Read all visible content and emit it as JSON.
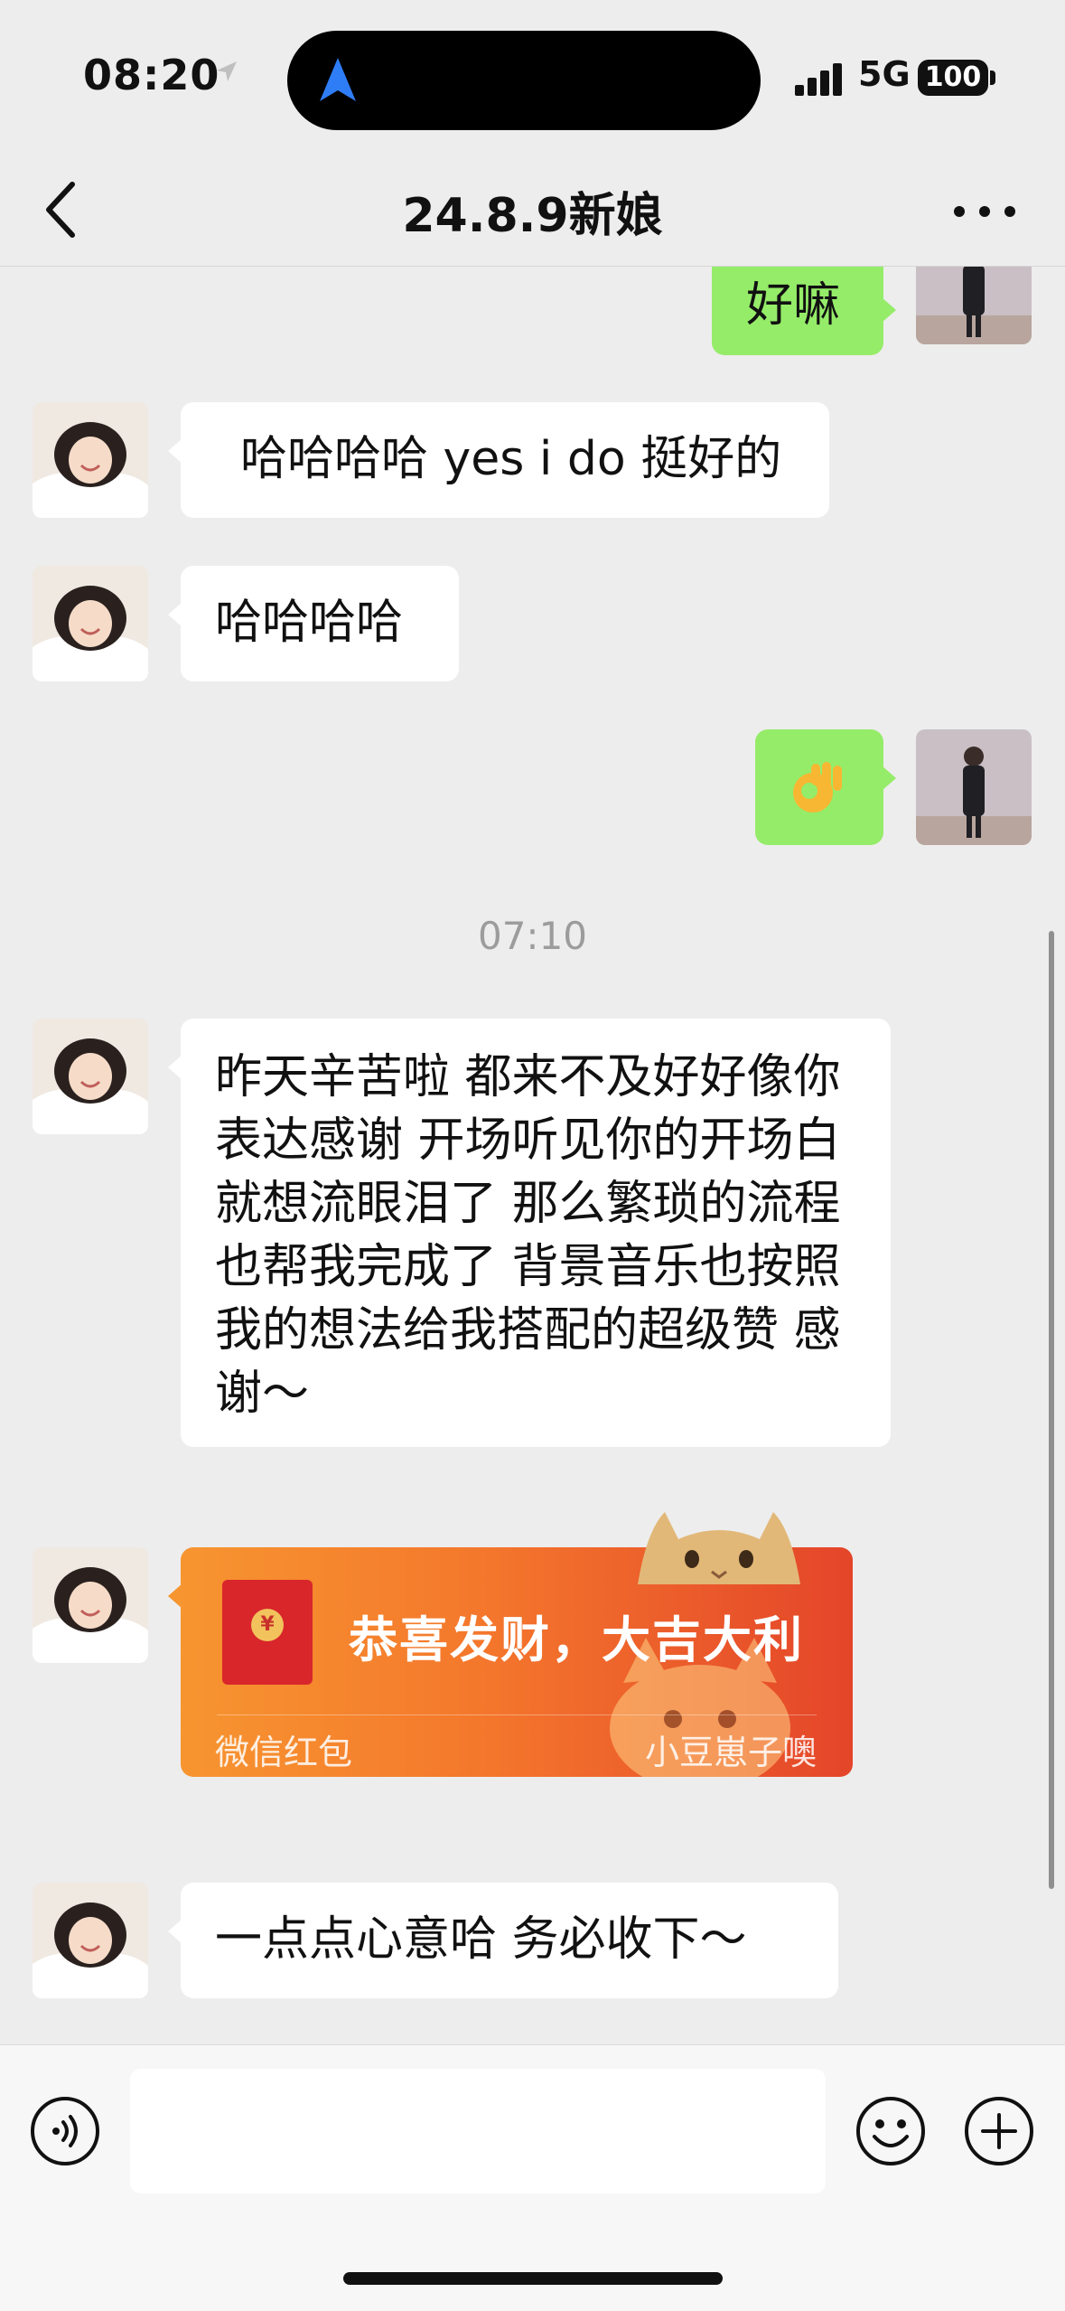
{
  "status_bar": {
    "time": "08:20",
    "network": "5G",
    "battery": "100"
  },
  "nav": {
    "title": "24.8.9新娘"
  },
  "messages": [
    {
      "side": "right",
      "text": "好嘛"
    },
    {
      "side": "left",
      "text": "哈哈哈哈 yes i do 挺好的"
    },
    {
      "side": "left",
      "text": "哈哈哈哈"
    },
    {
      "side": "right",
      "text": "👌",
      "icon": "ok-hand-icon"
    },
    {
      "side": "left",
      "text": "昨天辛苦啦 都来不及好好像你表达感谢 开场听见你的开场白就想流眼泪了 那么繁琐的流程也帮我完成了 背景音乐也按照我的想法给我搭配的超级赞 感谢～"
    },
    {
      "side": "left",
      "text": "一点点心意哈 务必收下～"
    }
  ],
  "timestamp": "07:10",
  "red_packet": {
    "title": "恭喜发财，大吉大利",
    "label": "微信红包",
    "sender": "小豆崽子噢",
    "coin": "¥"
  },
  "colors": {
    "self_bubble": "#95ec69",
    "peer_bubble": "#ffffff",
    "background": "#ededed",
    "packet_start": "#f79530",
    "packet_end": "#e4452a"
  },
  "input": {
    "value": "",
    "placeholder": ""
  }
}
